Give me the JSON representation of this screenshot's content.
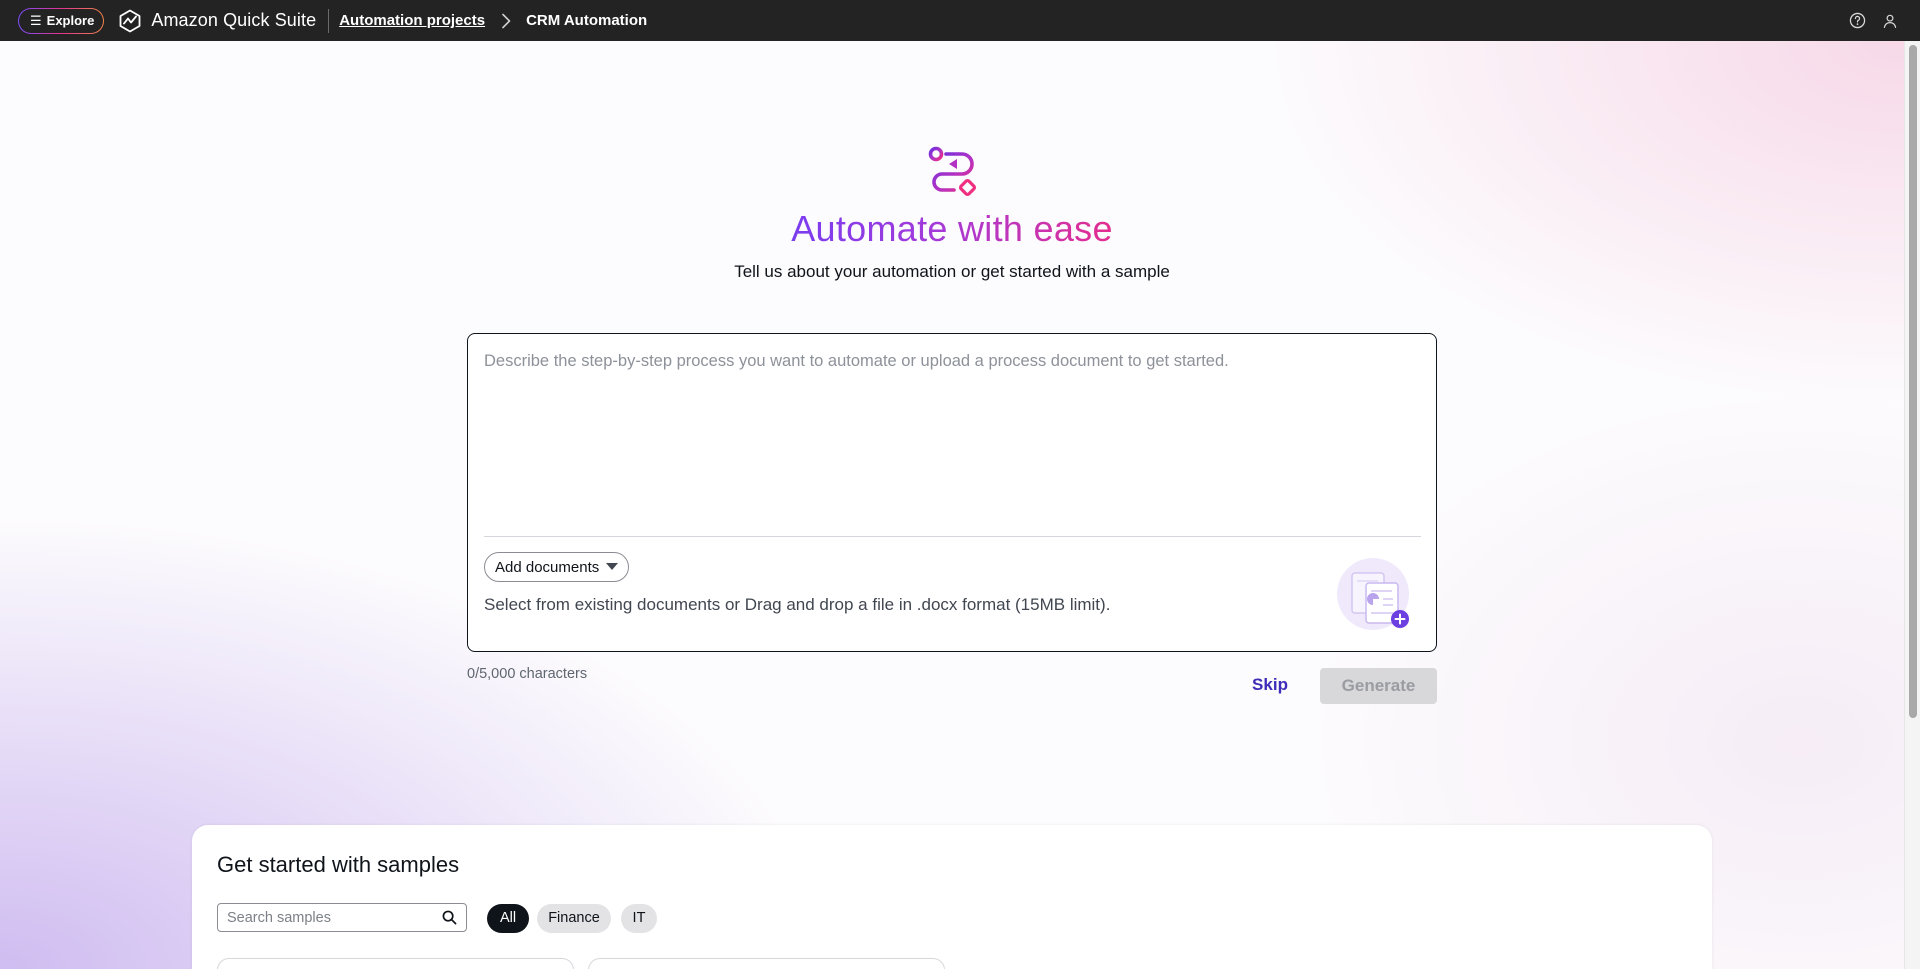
{
  "topbar": {
    "explore_label": "Explore",
    "brand_name": "Amazon Quick Suite",
    "breadcrumb": {
      "parent": "Automation projects",
      "current": "CRM Automation"
    },
    "icons": {
      "menu": "menu-icon",
      "logo": "quick-suite-logo-icon",
      "separator": "chevron-right-icon",
      "help": "help-circle-icon",
      "user": "user-icon"
    }
  },
  "hero": {
    "icon": "automation-flow-icon",
    "title": "Automate with ease",
    "subtitle": "Tell us about your automation or get started with a sample"
  },
  "prompt": {
    "placeholder": "Describe the step-by-step process you want to automate or upload a process document to get started.",
    "value": "",
    "add_documents_label": "Add documents",
    "drop_hint": "Select from existing documents or Drag and drop a file in .docx format (15MB limit).",
    "char_count": "0/5,000 characters",
    "skip_label": "Skip",
    "generate_label": "Generate",
    "generate_enabled": false
  },
  "samples": {
    "title": "Get started with samples",
    "search_placeholder": "Search samples",
    "filters": [
      {
        "label": "All",
        "active": true
      },
      {
        "label": "Finance",
        "active": false
      },
      {
        "label": "IT",
        "active": false
      }
    ]
  },
  "colors": {
    "topbar_bg": "#232323",
    "accent_purple": "#7a3df0",
    "accent_pink": "#e42d8f",
    "skip_link": "#3d2db8",
    "generate_disabled_bg": "#d8d8db"
  }
}
